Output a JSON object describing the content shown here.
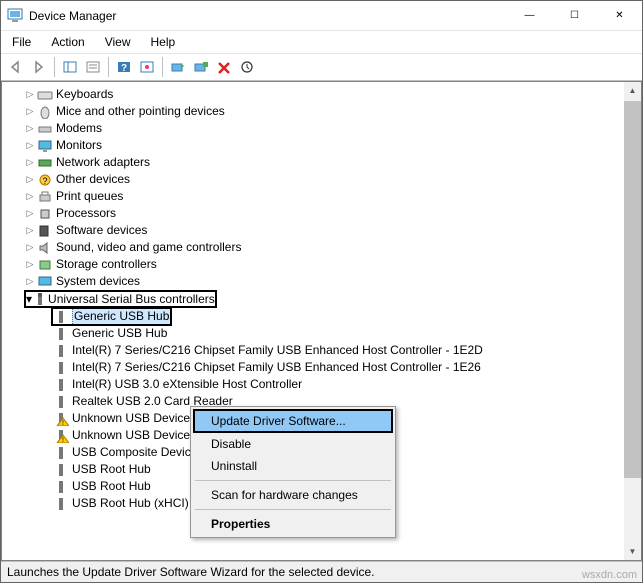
{
  "window": {
    "title": "Device Manager"
  },
  "menu": {
    "file": "File",
    "action": "Action",
    "view": "View",
    "help": "Help"
  },
  "tree": {
    "keyboards": "Keyboards",
    "mice": "Mice and other pointing devices",
    "modems": "Modems",
    "monitors": "Monitors",
    "network": "Network adapters",
    "other": "Other devices",
    "print": "Print queues",
    "processors": "Processors",
    "software": "Software devices",
    "sound": "Sound, video and game controllers",
    "storage": "Storage controllers",
    "system": "System devices",
    "usb": "Universal Serial Bus controllers",
    "usb_children": {
      "generic1": "Generic USB Hub",
      "generic2": "Generic USB Hub",
      "intel1": "Intel(R) 7 Series/C216 Chipset Family USB Enhanced Host Controller - 1E2D",
      "intel2": "Intel(R) 7 Series/C216 Chipset Family USB Enhanced Host Controller - 1E26",
      "intel3": "Intel(R) USB 3.0 eXtensible Host Controller",
      "realtek": "Realtek USB 2.0 Card Reader",
      "unknown1": "Unknown USB Device",
      "unknown2": "Unknown USB Device",
      "composite": "USB Composite Device",
      "root1": "USB Root Hub",
      "root2": "USB Root Hub",
      "root3": "USB Root Hub (xHCI)"
    }
  },
  "context": {
    "update": "Update Driver Software...",
    "disable": "Disable",
    "uninstall": "Uninstall",
    "scan": "Scan for hardware changes",
    "properties": "Properties"
  },
  "status": "Launches the Update Driver Software Wizard for the selected device.",
  "watermark": "wsxdn.com"
}
